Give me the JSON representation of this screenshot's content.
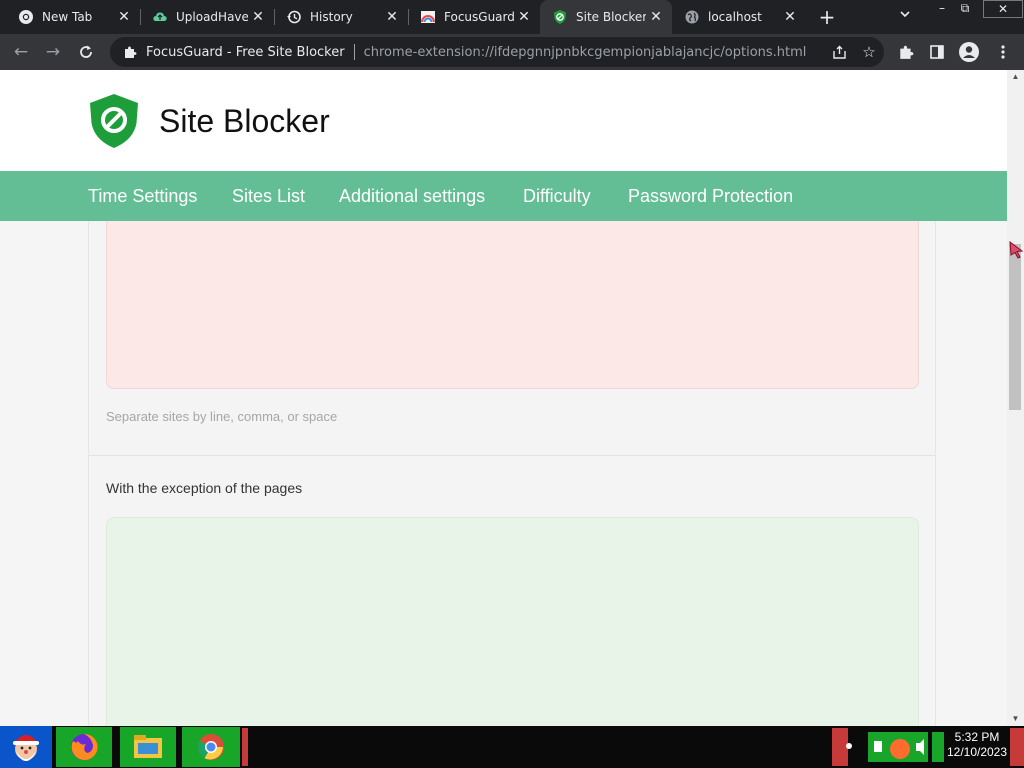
{
  "browser": {
    "tabs": [
      {
        "title": "New Tab",
        "icon": "chrome-icon",
        "active": false
      },
      {
        "title": "UploadHaven",
        "icon": "cloud-icon",
        "active": false
      },
      {
        "title": "History",
        "icon": "history-icon",
        "active": false
      },
      {
        "title": "FocusGuard",
        "icon": "rainbow-icon",
        "active": false
      },
      {
        "title": "Site Blocker",
        "icon": "shield-icon",
        "active": true
      },
      {
        "title": "localhost",
        "icon": "globe-icon",
        "active": false
      }
    ],
    "close_glyph": "✕",
    "new_tab_glyph": "+",
    "tab_list_glyph": "⌄",
    "window_controls": {
      "minimize": "–",
      "restore": "⧉",
      "close": "✕"
    },
    "omnibox": {
      "site_name": "FocusGuard - Free Site Blocker",
      "url": "chrome-extension://ifdepgnnjpnbkcgempionjablajancjc/options.html"
    }
  },
  "page": {
    "brand": "Site Blocker",
    "nav": [
      {
        "label": "Time Settings"
      },
      {
        "label": "Sites List"
      },
      {
        "label": "Additional settings"
      },
      {
        "label": "Difficulty"
      },
      {
        "label": "Password Protection"
      }
    ],
    "blocked_sites": {
      "value": "",
      "hint": "Separate sites by line, comma, or space"
    },
    "exceptions": {
      "label": "With the exception of the pages",
      "value": ""
    }
  },
  "taskbar": {
    "clock_time": "5:32 PM",
    "clock_date": "12/10/2023"
  },
  "colors": {
    "nav_bar": "#63be95",
    "shield": "#1e9e3b",
    "blocked_box": "#fde8e8",
    "exceptions_box": "#e8f4e7"
  }
}
